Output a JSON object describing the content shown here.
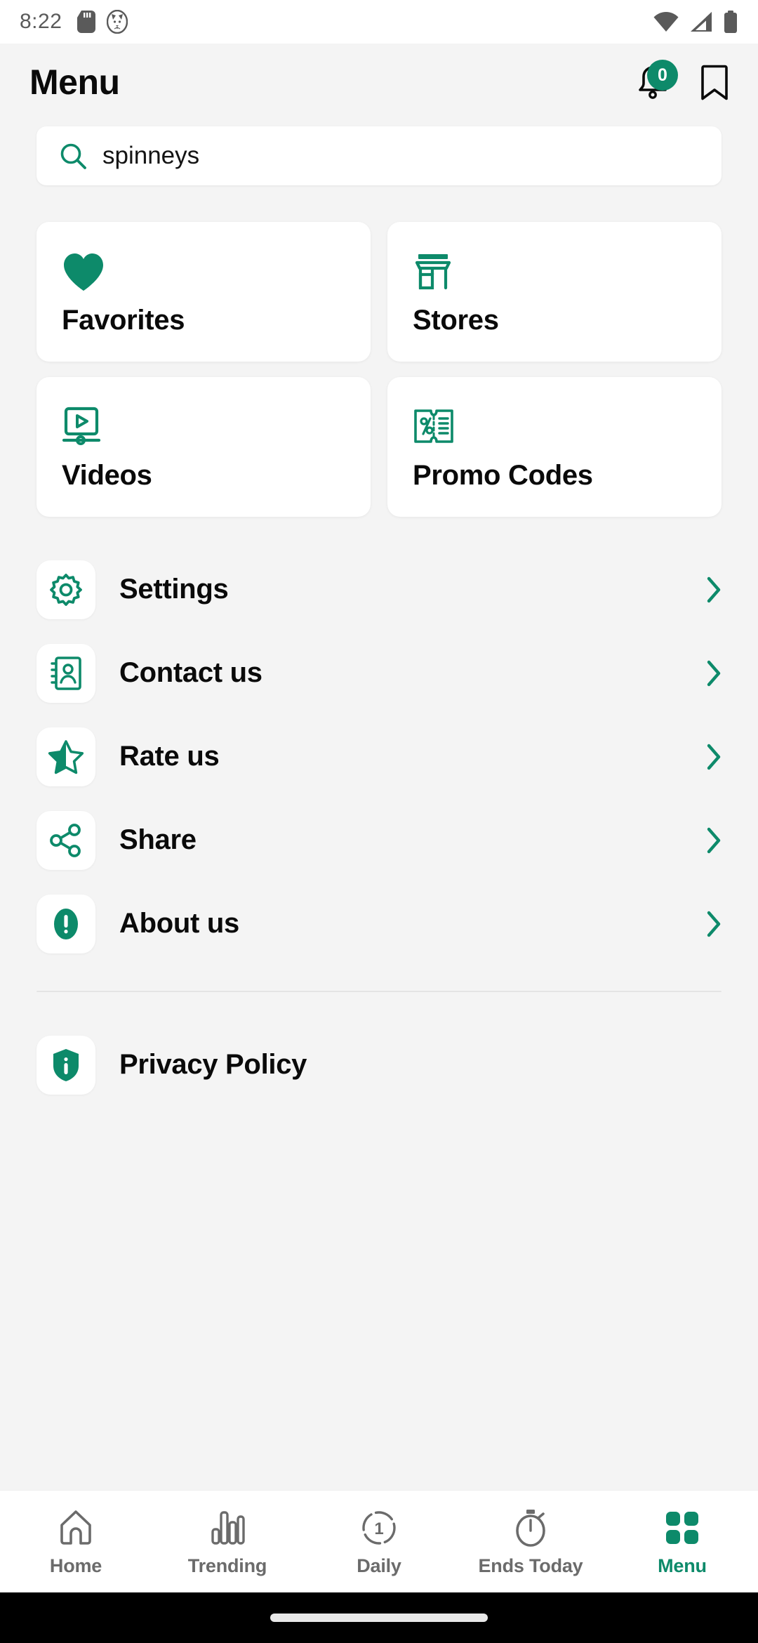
{
  "theme": {
    "accent": "#0d8a6a",
    "bg": "#f4f4f4",
    "card_bg": "#ffffff",
    "text": "#0a0a0a",
    "muted": "#6b6b6b"
  },
  "status_bar": {
    "time": "8:22",
    "icons": [
      "sd-card-icon",
      "cat-face-icon",
      "wifi-icon",
      "cellular-signal-icon",
      "battery-icon"
    ]
  },
  "header": {
    "title": "Menu",
    "notification_badge": "0",
    "icons": [
      "bell-icon",
      "bookmark-icon"
    ]
  },
  "search": {
    "value": "spinneys",
    "placeholder": "Search",
    "icon": "search-icon"
  },
  "grid": {
    "cards": [
      {
        "label": "Favorites",
        "icon": "heart-icon"
      },
      {
        "label": "Stores",
        "icon": "storefront-icon"
      },
      {
        "label": "Videos",
        "icon": "video-player-icon"
      },
      {
        "label": "Promo Codes",
        "icon": "coupon-percent-icon"
      }
    ]
  },
  "menu_list": {
    "items": [
      {
        "label": "Settings",
        "icon": "gear-icon",
        "chevron": true
      },
      {
        "label": "Contact us",
        "icon": "contact-card-icon",
        "chevron": true
      },
      {
        "label": "Rate us",
        "icon": "half-star-icon",
        "chevron": true
      },
      {
        "label": "Share",
        "icon": "share-nodes-icon",
        "chevron": true
      },
      {
        "label": "About us",
        "icon": "info-exclaim-icon",
        "chevron": true
      }
    ],
    "footer": [
      {
        "label": "Privacy Policy",
        "icon": "shield-info-icon",
        "chevron": false
      }
    ]
  },
  "bottom_nav": {
    "active": "Menu",
    "items": [
      {
        "label": "Home",
        "icon": "home-icon"
      },
      {
        "label": "Trending",
        "icon": "bar-chart-icon"
      },
      {
        "label": "Daily",
        "icon": "daily-one-icon"
      },
      {
        "label": "Ends Today",
        "icon": "stopwatch-icon"
      },
      {
        "label": "Menu",
        "icon": "grid-squares-icon"
      }
    ]
  }
}
